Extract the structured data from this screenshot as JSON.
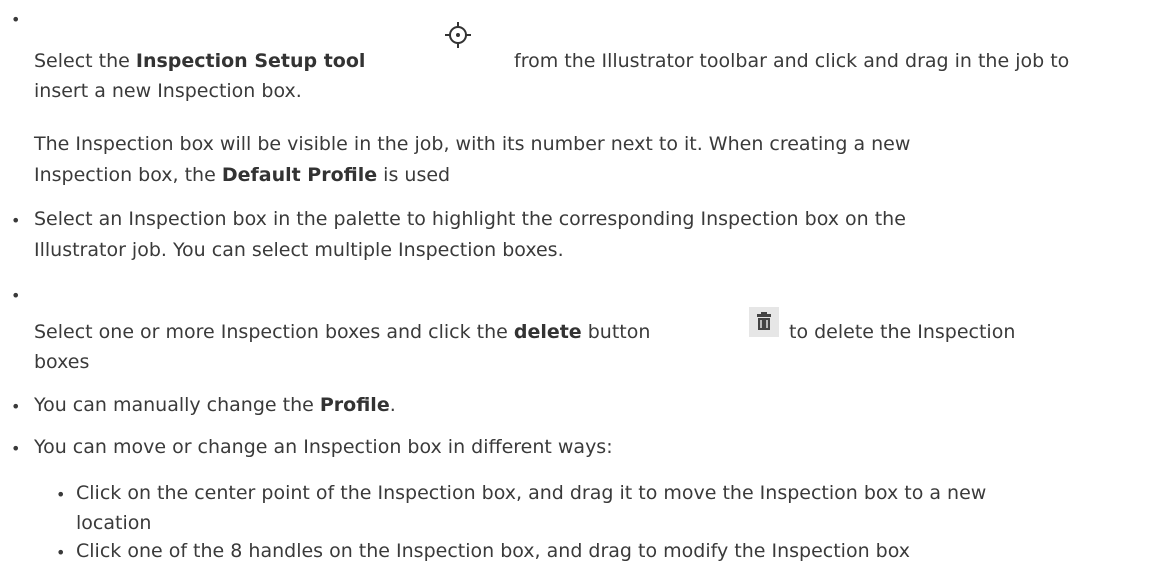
{
  "items": [
    {
      "line1_a": "Select the ",
      "line1_b": "Inspection Setup tool",
      "line1_c": "from the Illustrator toolbar and click and drag in the job to",
      "line2": "insert a new Inspection box.",
      "para_1": "The Inspection box will be visible in the job, with its number next to it. When creating a new",
      "para_2a": "Inspection box, the ",
      "para_2b": "Default Profile",
      "para_2c": " is used",
      "icon": "crosshair-target-icon"
    },
    {
      "line1": "Select an Inspection box in the palette to highlight the corresponding Inspection box on the",
      "line2": "Illustrator job. You can select multiple Inspection boxes."
    },
    {
      "line1_a": "Select one or more Inspection boxes and click the ",
      "line1_b": "delete",
      "line1_c": " button",
      "line1_d": "to delete the Inspection",
      "line2": "boxes",
      "icon": "trash-icon"
    },
    {
      "line1_a": "You can manually change the ",
      "line1_b": "Profile",
      "line1_c": "."
    },
    {
      "line1": "You can move or change an Inspection box in different ways:",
      "sub": [
        {
          "line1": "Click on the center point of the Inspection box, and drag it to move the Inspection box to a new",
          "line2": "location"
        },
        {
          "line1": "Click one of the 8 handles on the Inspection box, and drag to modify the Inspection box"
        }
      ]
    }
  ]
}
